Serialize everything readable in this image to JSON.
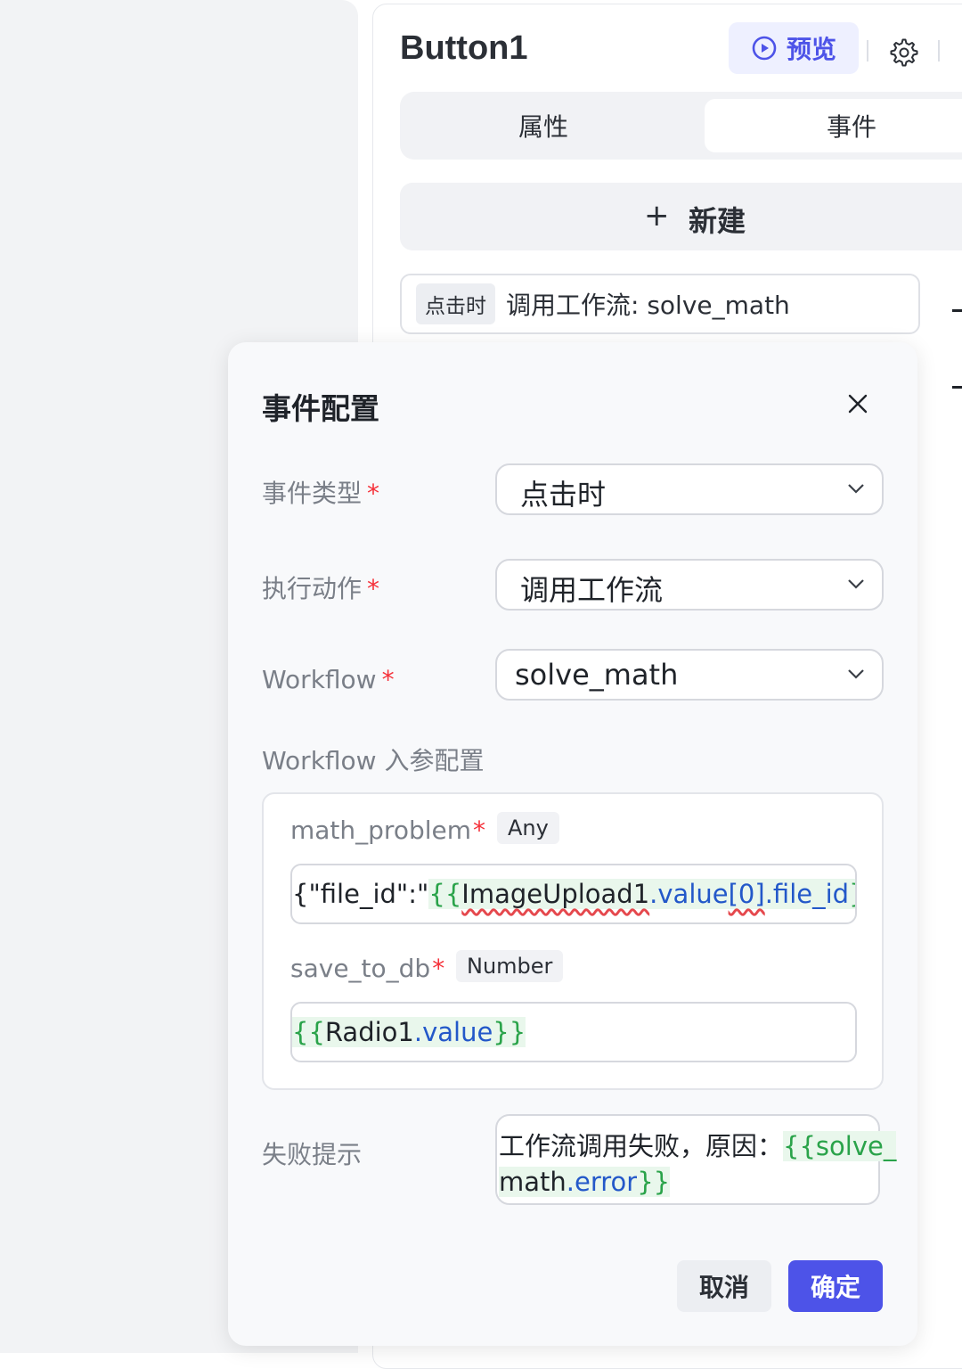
{
  "panel": {
    "title": "Button1",
    "preview_label": "预览",
    "tabs": [
      {
        "label": "属性",
        "active": false
      },
      {
        "label": "事件",
        "active": true
      }
    ],
    "new_label": "新建",
    "event": {
      "trigger_tag": "点击时",
      "summary": "调用工作流: solve_math"
    }
  },
  "modal": {
    "title": "事件配置",
    "fields": {
      "event_type": {
        "label": "事件类型",
        "required_mark": "*",
        "value": "点击时"
      },
      "action": {
        "label": "执行动作",
        "required_mark": "*",
        "value": "调用工作流"
      },
      "workflow": {
        "label": "Workflow",
        "required_mark": "*",
        "value": "solve_math"
      }
    },
    "params_section_label": "Workflow 入参配置",
    "params": [
      {
        "name": "math_problem",
        "required_mark": "*",
        "type": "Any",
        "value_tokens": {
          "t1": "{\"file_id\":\"",
          "t2": "{{",
          "t3": "ImageUpload1",
          "t4": ".value",
          "t5": "[0]",
          "t6": ".file_id",
          "t7": "}}",
          "t8": "\"}"
        }
      },
      {
        "name": "save_to_db",
        "required_mark": "*",
        "type": "Number",
        "value_tokens": {
          "t1": "{{ ",
          "t2": "Radio1",
          "t3": ".value",
          "t4": " }}"
        }
      }
    ],
    "fail_hint": {
      "label": "失败提示",
      "line1_text": "工作流调用失败，原因：",
      "line1_brace": "{{solve_",
      "line2_ref": "math",
      "line2_prop": ".error",
      "line2_brace": "}}"
    },
    "cancel_label": "取消",
    "ok_label": "确定"
  },
  "colors": {
    "primary": "#4d53e8",
    "required": "#f5313a",
    "expr_brace": "#2aa34a",
    "expr_prop": "#2358c9"
  },
  "icons": [
    "play-circle-icon",
    "gear-icon",
    "plus-icon",
    "close-icon",
    "chevron-down-icon"
  ]
}
